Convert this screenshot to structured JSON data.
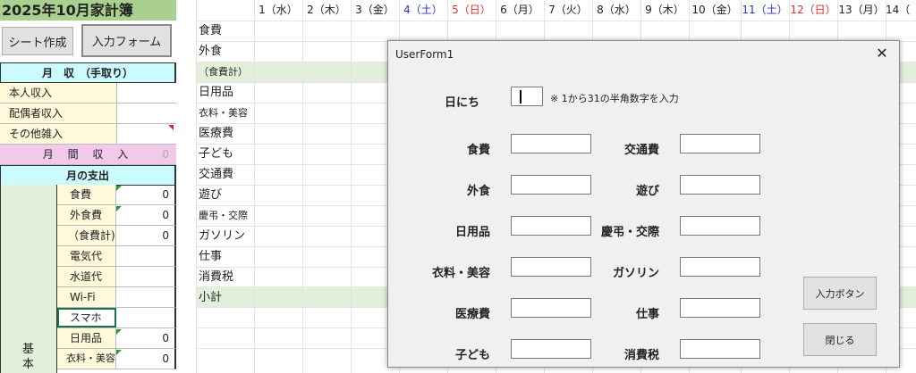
{
  "sheet": {
    "title": "2025年10月家計簿",
    "buttons": {
      "sheet_create": "シート作成",
      "input_form": "入力フォーム"
    },
    "income": {
      "header": "月　収　（手取り）",
      "rows": [
        "本人収入",
        "配偶者収入",
        "その他雑入"
      ],
      "total_label": "月 間 収 入",
      "total_value": "0"
    },
    "expense": {
      "header": "月の支出",
      "group_label_1": "基",
      "group_label_2": "本",
      "rows": [
        {
          "label": "食費",
          "value": "0"
        },
        {
          "label": "外食費",
          "value": "0"
        },
        {
          "label": "（食費計)",
          "value": "0"
        },
        {
          "label": "電気代",
          "value": ""
        },
        {
          "label": "水道代",
          "value": ""
        },
        {
          "label": "Wi-Fi",
          "value": ""
        },
        {
          "label": "スマホ",
          "value": ""
        },
        {
          "label": "日用品",
          "value": "0"
        },
        {
          "label": "衣料・美容",
          "value": "0"
        }
      ]
    },
    "categories": [
      "食費",
      "外食",
      "（食費計）",
      "日用品",
      "衣料・美容",
      "医療費",
      "子ども",
      "交通費",
      "遊び",
      "慶弔・交際",
      "ガソリン",
      "仕事",
      "消費税",
      "小計"
    ],
    "days": [
      {
        "label": "1（水）",
        "color": "normal"
      },
      {
        "label": "2（木）",
        "color": "normal"
      },
      {
        "label": "3（金）",
        "color": "normal"
      },
      {
        "label": "4（土）",
        "color": "blue"
      },
      {
        "label": "5（日）",
        "color": "red"
      },
      {
        "label": "6（月）",
        "color": "normal"
      },
      {
        "label": "7（火）",
        "color": "normal"
      },
      {
        "label": "8（水）",
        "color": "normal"
      },
      {
        "label": "9（木）",
        "color": "normal"
      },
      {
        "label": "10（金）",
        "color": "normal"
      },
      {
        "label": "11（土）",
        "color": "blue"
      },
      {
        "label": "12（日）",
        "color": "red"
      },
      {
        "label": "13（月）",
        "color": "normal"
      },
      {
        "label": "14（",
        "color": "normal"
      }
    ]
  },
  "form": {
    "title": "UserForm1",
    "close_glyph": "✕",
    "day_label": "日にち",
    "day_note": "※ 1から31の半角数字を入力",
    "left_fields": [
      "食費",
      "外食",
      "日用品",
      "衣料・美容",
      "医療費",
      "子ども"
    ],
    "right_fields": [
      "交通費",
      "遊び",
      "慶弔・交際",
      "ガソリン",
      "仕事",
      "消費税"
    ],
    "input_button": "入力ボタン",
    "close_button": "閉じる"
  },
  "colors": {
    "title_green": "#a9d08e",
    "band_green": "#e2efda",
    "header_cyan": "#ccfbff",
    "label_yellow": "#fff9db",
    "total_pink": "#f2c9ea",
    "saturday_blue": "#2a35c8",
    "sunday_red": "#e03030"
  }
}
